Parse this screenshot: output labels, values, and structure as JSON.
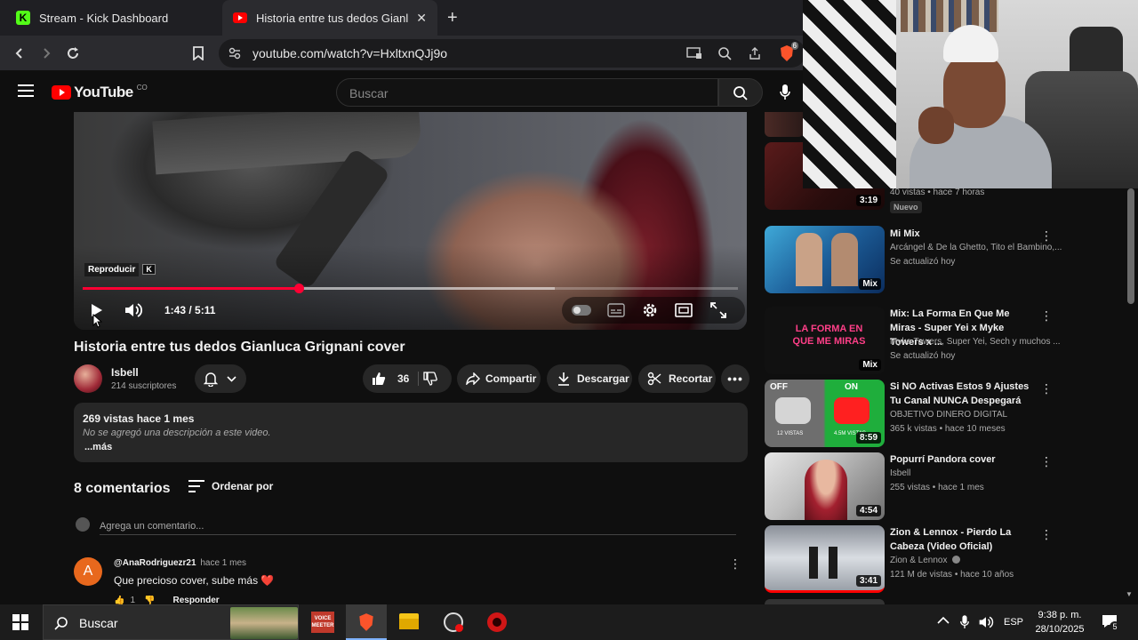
{
  "browser": {
    "tabs": [
      {
        "title": "Stream - Kick Dashboard",
        "favicon": "K",
        "active": false
      },
      {
        "title": "Historia entre tus dedos Gianluca",
        "active": true
      }
    ],
    "url": "youtube.com/watch?v=HxltxnQJj9o",
    "brave_badge": "6"
  },
  "youtube": {
    "logo_text": "YouTube",
    "country": "CO",
    "search_placeholder": "Buscar"
  },
  "player": {
    "tooltip": "Reproducir",
    "tooltip_key": "K",
    "time": "1:43 / 5:11",
    "progress_fraction": 0.33,
    "buffered_fraction": 0.72
  },
  "video": {
    "title": "Historia entre tus dedos Gianluca Grignani cover",
    "channel_name": "Isbell",
    "subscribers": "214 suscriptores",
    "likes": "36",
    "share_label": "Compartir",
    "download_label": "Descargar",
    "clip_label": "Recortar",
    "views_date": "269 vistas  hace 1 mes",
    "description": "No se agregó una descripción a este video.",
    "more_label": "...más"
  },
  "comments": {
    "count_label": "8 comentarios",
    "sort_label": "Ordenar por",
    "add_placeholder": "Agrega un comentario...",
    "items": [
      {
        "author": "@AnaRodriguezr21",
        "time": "hace 1 mes",
        "text": "Que precioso cover, sube más ❤️",
        "likes": "1",
        "reply_label": "Responder",
        "avatar_letter": "A"
      }
    ]
  },
  "sidebar": {
    "items": [
      {
        "title": "",
        "lines": [
          "40 vistas • hace 7 horas"
        ],
        "badge": "Nuevo",
        "duration": "3:19"
      },
      {
        "title": "Mi Mix",
        "lines": [
          "Arcángel & De la Ghetto, Tito el Bambino,...",
          "Se actualizó hoy"
        ],
        "duration": "Mix"
      },
      {
        "title": "Mix: La Forma En Que Me Miras - Super Yei x Myke Towers x ...",
        "lines": [
          "Myke Towers, Super Yei, Sech y muchos ...",
          "Se actualizó hoy"
        ],
        "duration": "Mix",
        "thumb_text": "LA FORMA EN QUE ME MIRAS"
      },
      {
        "title": "Si NO Activas Estos 9 Ajustes Tu Canal NUNCA Despegará",
        "lines": [
          "OBJETIVO DINERO DIGITAL",
          "365 k vistas • hace 10 meses"
        ],
        "duration": "8:59",
        "thumb_off": "OFF",
        "thumb_on": "ON",
        "thumb_views_a": "12 VISTAS",
        "thumb_views_b": "4.5M VISTAS"
      },
      {
        "title": "Popurrí Pandora cover",
        "lines": [
          "Isbell",
          "255 vistas • hace 1 mes"
        ],
        "duration": "4:54"
      },
      {
        "title": "Zion & Lennox - Pierdo La Cabeza (Video Oficial)",
        "lines": [
          "Zion & Lennox",
          "121 M de vistas • hace 10 años"
        ],
        "duration": "3:41"
      }
    ]
  },
  "taskbar": {
    "search_label": "Buscar",
    "voicemeeter_label": "VOICE MEETER",
    "language": "ESP",
    "time": "9:38 p. m.",
    "date": "28/10/2025",
    "notifications": "5"
  },
  "colors": {
    "youtube_red": "#ff0000",
    "progress_red": "#f03",
    "kick_green": "#53fc18"
  }
}
